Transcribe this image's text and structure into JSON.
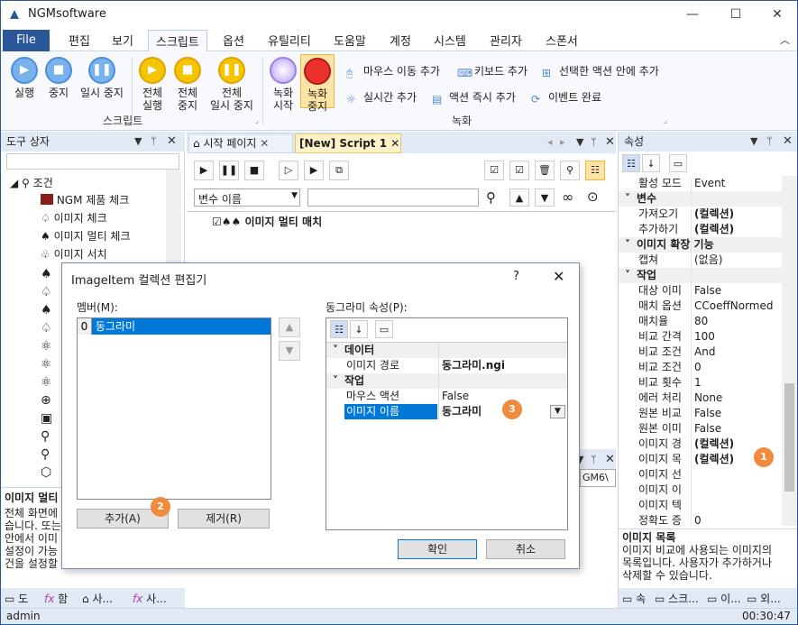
{
  "app": {
    "title": "NGMsoftware"
  },
  "menu": {
    "file": "File",
    "items": [
      "편집",
      "보기",
      "스크립트",
      "옵션",
      "유틸리티",
      "도움말",
      "계정",
      "시스템",
      "관리자",
      "스폰서"
    ]
  },
  "ribbon": {
    "run": "실행",
    "stop": "중지",
    "pause": "일시 중지",
    "all_run_1": "전체",
    "all_run_2": "실행",
    "all_stop_1": "전체",
    "all_stop_2": "중지",
    "all_pause_1": "전체",
    "all_pause_2": "일시 중지",
    "group_script": "스크립트",
    "rec_start_1": "녹화",
    "rec_start_2": "시작",
    "rec_stop_1": "녹화",
    "rec_stop_2": "중지",
    "mouse_move": "마우스 이동 추가",
    "keyboard": "키보드 추가",
    "selected_action": "선택한 액션 안에 추가",
    "realtime": "실시간 추가",
    "action_now": "액션 즉시 추가",
    "event_done": "이벤트 완료",
    "group_record": "녹화"
  },
  "toolbox": {
    "title": "도구 상자",
    "root": "조건",
    "items": [
      "NGM 제품 체크",
      "이미지 체크",
      "이미지 멀티 체크",
      "이미지 서치"
    ],
    "desc_title": "이미지 멀티",
    "desc_lines": [
      "전체 화면에",
      "습니다. 또는",
      "안에서 이미",
      "설정이 가능",
      "건을 설정할"
    ],
    "bottom_tabs": [
      "도",
      "함",
      "사...",
      "사..."
    ]
  },
  "editor": {
    "tab_start": "시작 페이지",
    "tab_script": "[New] Script 1",
    "var_placeholder": "변수 이름",
    "node": "이미지 멀티 매치",
    "right_tail": "GM6\\"
  },
  "properties": {
    "title": "속성",
    "rows": [
      {
        "k": "활성 모드",
        "v": "Event",
        "cat": false
      },
      {
        "k": "변수",
        "v": "",
        "cat": true
      },
      {
        "k": "가져오기",
        "v": "(컬렉션)",
        "cat": false,
        "bold": true
      },
      {
        "k": "추가하기",
        "v": "(컬렉션)",
        "cat": false,
        "bold": true
      },
      {
        "k": "이미지 확장 기능",
        "v": "",
        "cat": true
      },
      {
        "k": "캡쳐",
        "v": "(없음)",
        "cat": false
      },
      {
        "k": "작업",
        "v": "",
        "cat": true
      },
      {
        "k": "대상 이미",
        "v": "False",
        "cat": false
      },
      {
        "k": "매치 옵션",
        "v": "CCoeffNormed",
        "cat": false
      },
      {
        "k": "매치율",
        "v": "80",
        "cat": false
      },
      {
        "k": "비교 간격",
        "v": "100",
        "cat": false
      },
      {
        "k": "비교 조건",
        "v": "And",
        "cat": false
      },
      {
        "k": "비교 조건",
        "v": "0",
        "cat": false
      },
      {
        "k": "비교 횟수",
        "v": "1",
        "cat": false
      },
      {
        "k": "에러 처리",
        "v": "None",
        "cat": false
      },
      {
        "k": "원본 비교",
        "v": "False",
        "cat": false
      },
      {
        "k": "원본 이미",
        "v": "False",
        "cat": false
      },
      {
        "k": "이미지 경",
        "v": "(컬렉션)",
        "cat": false,
        "bold": true
      },
      {
        "k": "이미지 목",
        "v": "(컬렉션)",
        "cat": false,
        "bold": true
      },
      {
        "k": "이미지 선",
        "v": "",
        "cat": false
      },
      {
        "k": "이미지 이",
        "v": "",
        "cat": false
      },
      {
        "k": "이미지 텍",
        "v": "",
        "cat": false
      },
      {
        "k": "정확도 증",
        "v": "0",
        "cat": false
      }
    ],
    "desc_title": "이미지 목록",
    "desc_lines": [
      "이미지 비교에 사용되는 이미지의",
      "목록입니다. 사용자가 추가하거나",
      "삭제할 수 있습니다."
    ],
    "bottom_tabs": [
      "속",
      "스크...",
      "이...",
      "외..."
    ]
  },
  "dialog": {
    "title": "ImageItem 컬렉션 편집기",
    "help": "?",
    "members_label": "멤버(M):",
    "member_index": "0",
    "member_name": "동그라미",
    "props_label": "동그라미 속성(P):",
    "cat_data": "데이터",
    "cat_work": "작업",
    "rows": [
      {
        "k": "이미지 경로",
        "v": "동그라미.ngi"
      },
      {
        "k": "마우스 액션",
        "v": "False"
      },
      {
        "k": "이미지 이름",
        "v": "동그라미"
      }
    ],
    "add": "추가(A)",
    "remove": "제거(R)",
    "ok": "확인",
    "cancel": "취소"
  },
  "badges": [
    "1",
    "2",
    "3"
  ],
  "status": {
    "user": "admin",
    "time": "00:30:47"
  }
}
